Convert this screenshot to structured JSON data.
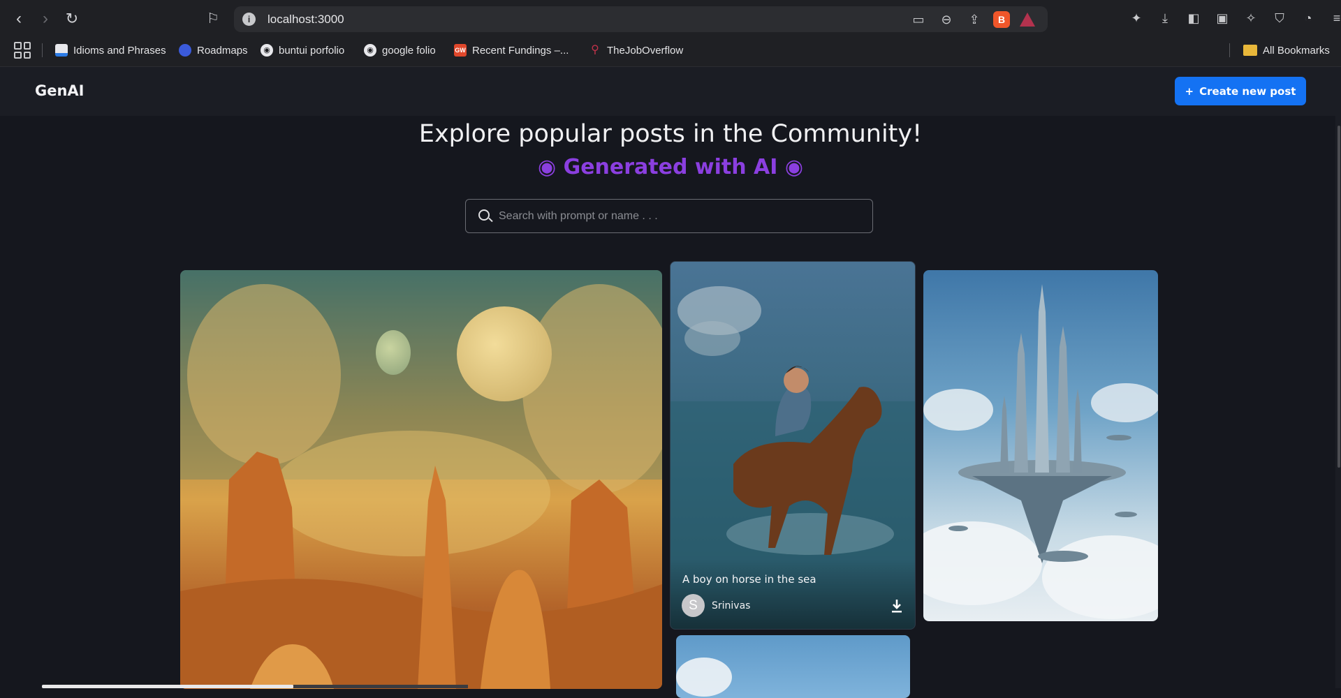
{
  "browser": {
    "url": "localhost:3000",
    "bookmarks": [
      {
        "label": "Idioms and Phrases"
      },
      {
        "label": "Roadmaps"
      },
      {
        "label": "buntui porfolio"
      },
      {
        "label": "google folio"
      },
      {
        "label": "Recent Fundings –..."
      },
      {
        "label": "TheJobOverflow"
      }
    ],
    "all_bookmarks_label": "All Bookmarks"
  },
  "header": {
    "logo": "GenAI",
    "create_button": "Create new post",
    "create_icon": "+"
  },
  "hero": {
    "title": "Explore popular posts in the Community!",
    "subtitle": "◉ Generated with AI ◉"
  },
  "search": {
    "placeholder": "Search with prompt or name . . ."
  },
  "posts": [
    {
      "prompt": "A boy on horse in the sea",
      "author": "Srinivas",
      "avatar_letter": "S"
    }
  ],
  "colors": {
    "accent": "#1472f3",
    "subtitle": "#8b3fe0",
    "background": "#15171e"
  }
}
